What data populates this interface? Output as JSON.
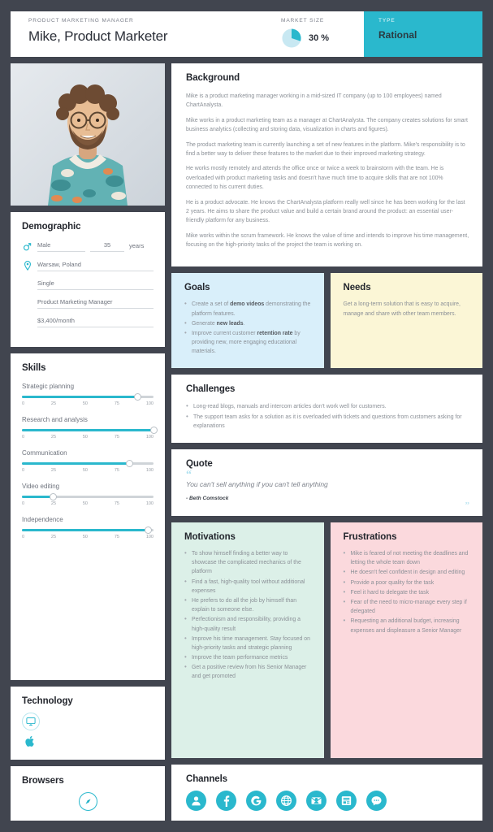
{
  "header": {
    "role_label": "PRODUCT MARKETING MANAGER",
    "name": "Mike, Product Marketer",
    "market_size_label": "MARKET SIZE",
    "market_size_value": "30 %",
    "market_size_pct": 30,
    "type_label": "TYPE",
    "type_value": "Rational",
    "accent_color": "#2ab8cd"
  },
  "photo": {
    "alt": "Portrait of bearded man with glasses in floral shirt"
  },
  "demographic": {
    "title": "Demographic",
    "gender": "Male",
    "age": "35",
    "age_units": "years",
    "location": "Warsaw, Poland",
    "marital_status": "Single",
    "occupation": "Product Marketing Manager",
    "income": "$3,400/month"
  },
  "skills": {
    "title": "Skills",
    "scale": [
      "0",
      "25",
      "50",
      "75",
      "100"
    ],
    "items": [
      {
        "name": "Strategic planning",
        "value": 88
      },
      {
        "name": "Research and analysis",
        "value": 100
      },
      {
        "name": "Communication",
        "value": 82
      },
      {
        "name": "Video editing",
        "value": 24
      },
      {
        "name": "Independence",
        "value": 96
      }
    ]
  },
  "technology": {
    "title": "Technology",
    "items": [
      {
        "name": "desktop-monitor-icon"
      },
      {
        "name": "apple-logo-icon"
      }
    ]
  },
  "browsers": {
    "title": "Browsers",
    "items": [
      {
        "name": "safari-compass-icon"
      }
    ]
  },
  "background": {
    "title": "Background",
    "paragraphs": [
      "Mike is a product marketing manager working in a mid-sized IT company (up to 100 employees) named ChartAnalysta.",
      "Mike works in a product marketing team as a manager at ChartAnalysta. The company creates solutions for smart business analytics (collecting and storing data, visualization in charts and figures).",
      "The product marketing team is currently launching a set of new features in the platform. Mike's responsibility is to find a better way to deliver these features to the market due to their improved marketing strategy.",
      "He works mostly remotely and attends the office once or twice a week to brainstorm with the team. He is overloaded with product marketing tasks and doesn't have much time to acquire skills that are not 100% connected to his current duties.",
      "He is a product advocate. He knows the ChartAnalysta platform really well since he has been working for the last 2 years. He aims to share the product value and build a certain brand around the product: an essential user-friendly platform for any business.",
      "Mike works within the scrum framework. He knows the value of time and intends to improve his time management, focusing on the high-priority tasks of the project the team is working on."
    ]
  },
  "goals": {
    "title": "Goals",
    "bg_color": "#d9effa",
    "items": [
      "Create a set of <b>demo videos</b> demonstrating the platform features.",
      "Generate <b>new leads</b>.",
      "Improve current customer <b>retention rate</b> by providing new, more engaging educational materials."
    ]
  },
  "needs": {
    "title": "Needs",
    "bg_color": "#fbf6d6",
    "text": "Get a long-term solution that is easy to acquire, manage and share with other team members."
  },
  "challenges": {
    "title": "Challenges",
    "items": [
      "Long-read blogs, manuals and intercom articles don't work well for customers.",
      "The support team asks for a solution as it is overloaded with tickets and questions from customers asking for explanations"
    ]
  },
  "quote": {
    "title": "Quote",
    "open_mark": "“",
    "close_mark": "”",
    "text": "You can't sell anything if you can't tell anything",
    "author": "- Beth Comstock"
  },
  "motivations": {
    "title": "Motivations",
    "bg_color": "#dcf0e8",
    "items": [
      "To show himself finding a better way to showcase the complicated mechanics of the platform",
      "Find a fast, high-quality tool without additional expenses",
      "He prefers to do all the job by himself than explain to someone else.",
      "Perfectionism and responsibility, providing a high-quality result",
      "Improve his time management. Stay focused on high-priority tasks and strategic planning",
      "Improve the team performance metrics",
      "Get a positive review from his Senior Manager and get promoted"
    ]
  },
  "frustrations": {
    "title": "Frustrations",
    "bg_color": "#fbd9dd",
    "items": [
      "Mike is feared of not meeting the deadlines and letting the whole team down",
      "He doesn't feel confident in design and editing",
      "Provide a poor quality for the task",
      "Feel it hard to delegate the task",
      "Fear of the need to micro-manage every step if delegated",
      "Requesting an additional budget, increasing expenses and displeasure a Senior Manager"
    ]
  },
  "channels": {
    "title": "Channels",
    "items": [
      {
        "name": "person-icon"
      },
      {
        "name": "facebook-icon"
      },
      {
        "name": "google-icon"
      },
      {
        "name": "globe-web-icon"
      },
      {
        "name": "email-newsletter-icon"
      },
      {
        "name": "blog-article-icon"
      },
      {
        "name": "chat-message-icon"
      }
    ]
  }
}
